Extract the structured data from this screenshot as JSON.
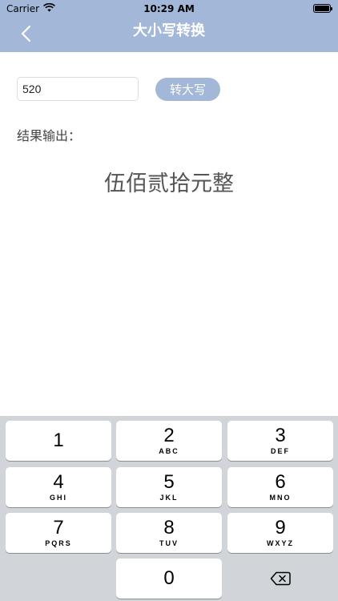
{
  "status_bar": {
    "carrier": "Carrier",
    "time": "10:29 AM"
  },
  "nav": {
    "title": "大小写转换"
  },
  "form": {
    "input_value": "520",
    "convert_button_label": "转大写"
  },
  "result": {
    "label": "结果输出：",
    "value": "伍佰贰拾元整"
  },
  "keyboard": {
    "keys": [
      {
        "digit": "1",
        "letters": ""
      },
      {
        "digit": "2",
        "letters": "ABC"
      },
      {
        "digit": "3",
        "letters": "DEF"
      },
      {
        "digit": "4",
        "letters": "GHI"
      },
      {
        "digit": "5",
        "letters": "JKL"
      },
      {
        "digit": "6",
        "letters": "MNO"
      },
      {
        "digit": "7",
        "letters": "PQRS"
      },
      {
        "digit": "8",
        "letters": "TUV"
      },
      {
        "digit": "9",
        "letters": "WXYZ"
      },
      {
        "digit": "0",
        "letters": ""
      }
    ],
    "delete_icon": "delete-backward-icon"
  },
  "colors": {
    "accent": "#a3b7d9",
    "keyboard_bg": "#d1d4d9"
  }
}
